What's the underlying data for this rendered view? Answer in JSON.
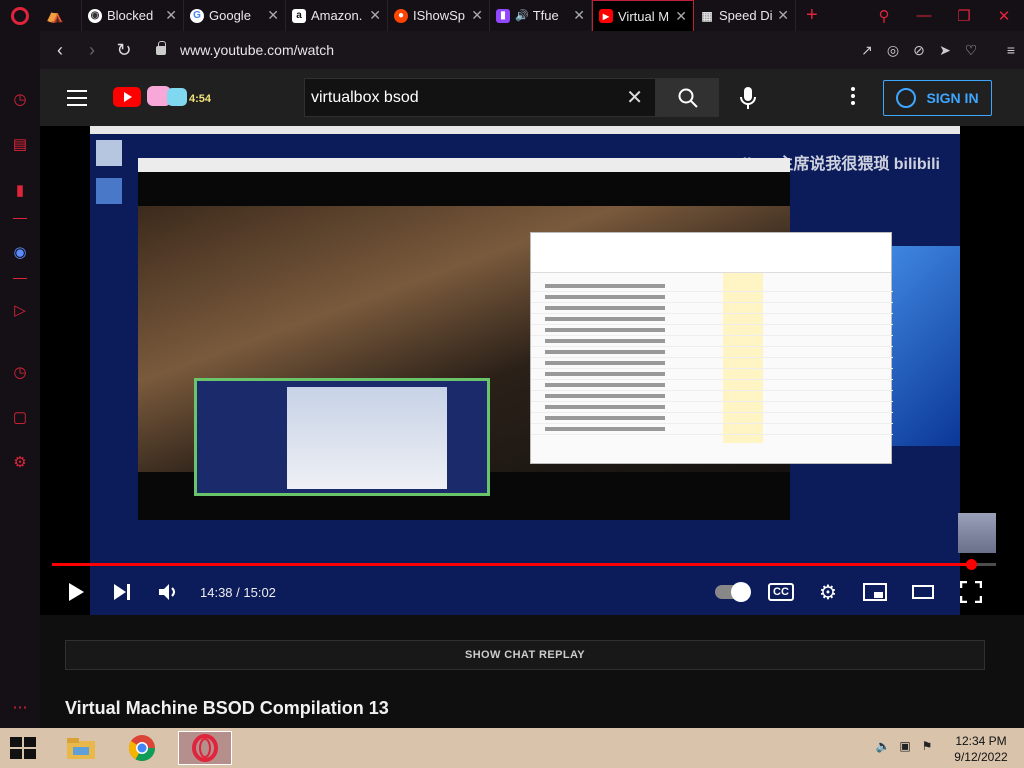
{
  "browser": {
    "tabs": [
      {
        "title": "Blocked",
        "icon": "globe-icon",
        "active": false
      },
      {
        "title": "Google",
        "icon": "google-icon",
        "active": false
      },
      {
        "title": "Amazon.",
        "icon": "amazon-icon",
        "active": false
      },
      {
        "title": "IShowSp",
        "icon": "reddit-icon",
        "active": false
      },
      {
        "title": "Tfue",
        "icon": "twitch-icon",
        "active": false
      },
      {
        "title": "Virtual M",
        "icon": "youtube-icon",
        "active": true
      },
      {
        "title": "Speed Di",
        "icon": "speed-dial-icon",
        "active": false
      }
    ],
    "url": "www.youtube.com/watch",
    "accent": "#e0243b"
  },
  "youtube": {
    "search_query": "virtualbox bsod",
    "sign_in_label": "SIGN IN",
    "watermark": "Albert主席说我很猥琐  bilibili",
    "time_display": "14:38 / 15:02",
    "progress_fraction": 0.973,
    "chat_replay_label": "SHOW CHAT REPLAY",
    "video_title": "Virtual Machine BSOD Compilation 13",
    "progress_color": "#ff0000",
    "signin_color": "#3ea6ff"
  },
  "taskbar": {
    "time": "12:34 PM",
    "date": "9/12/2022",
    "apps": [
      "file-explorer-icon",
      "chrome-icon",
      "opera-icon"
    ]
  }
}
